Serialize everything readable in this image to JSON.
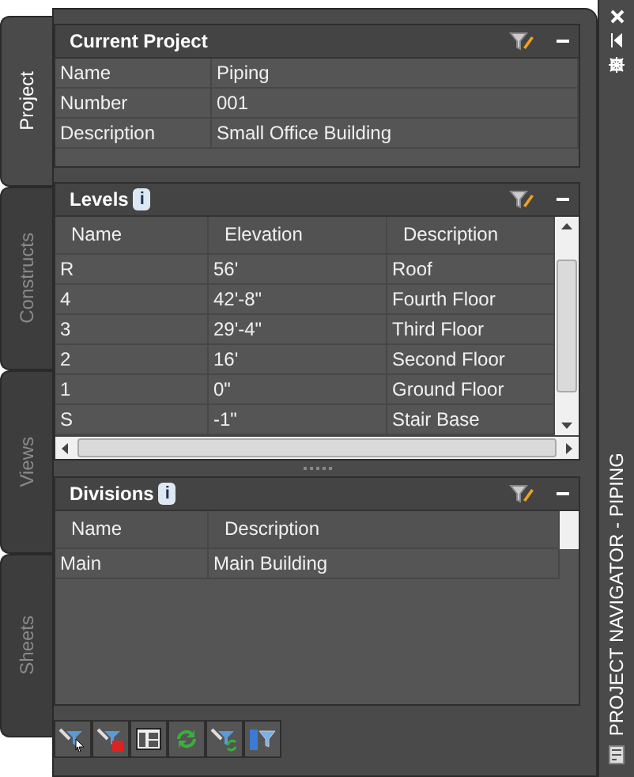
{
  "tabs": [
    {
      "label": "Project",
      "selected": true
    },
    {
      "label": "Constructs",
      "selected": false
    },
    {
      "label": "Views",
      "selected": false
    },
    {
      "label": "Sheets",
      "selected": false
    }
  ],
  "palette_title": "PROJECT NAVIGATOR - PIPING",
  "current_project": {
    "title": "Current Project",
    "rows": [
      {
        "label": "Name",
        "value": "Piping"
      },
      {
        "label": "Number",
        "value": "001"
      },
      {
        "label": "Description",
        "value": "Small Office Building"
      }
    ]
  },
  "levels": {
    "title": "Levels",
    "badge": "i",
    "columns": [
      "Name",
      "Elevation",
      "Description"
    ],
    "rows": [
      [
        "R",
        "56'",
        "Roof"
      ],
      [
        "4",
        "42'-8\"",
        "Fourth Floor"
      ],
      [
        "3",
        "29'-4\"",
        "Third Floor"
      ],
      [
        "2",
        "16'",
        "Second Floor"
      ],
      [
        "1",
        "0\"",
        "Ground Floor"
      ],
      [
        "S",
        "-1\"",
        "Stair Base"
      ]
    ]
  },
  "divisions": {
    "title": "Divisions",
    "badge": "i",
    "columns": [
      "Name",
      "Description"
    ],
    "rows": [
      [
        "Main",
        "Main Building"
      ]
    ]
  },
  "toolbar": [
    {
      "kind": "select"
    },
    {
      "kind": "delete"
    },
    {
      "kind": "layout"
    },
    {
      "kind": "refresh"
    },
    {
      "kind": "regenerate"
    },
    {
      "kind": "book"
    }
  ]
}
